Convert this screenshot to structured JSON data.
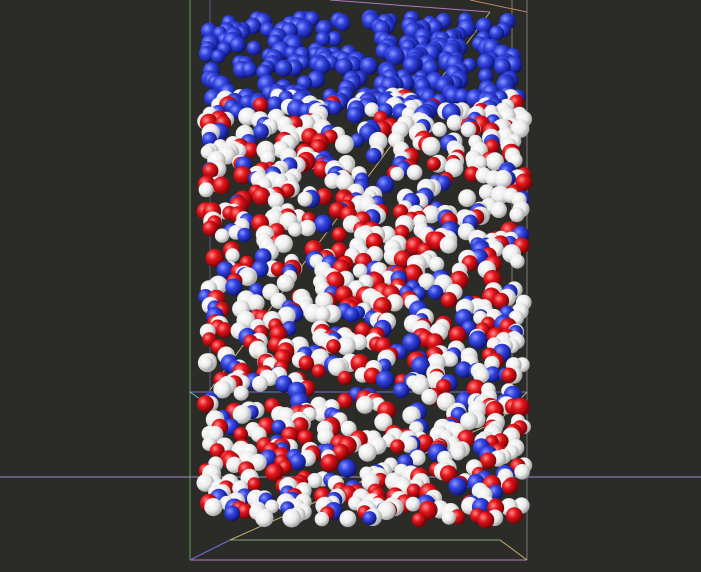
{
  "viewer": {
    "background_color": "#2b2b28"
  },
  "colors": {
    "blue_atom": "#2f3fd6",
    "red_atom": "#e0141a",
    "white_atom": "#f2f2f2",
    "box_edge_green": "#7faa6b",
    "box_edge_blue": "#6f6fd8",
    "box_edge_purple": "#b87ad0",
    "box_edge_yellow": "#c9b070",
    "box_edge_cyan": "#77b6c9",
    "axis_line": "#b0a0d0"
  },
  "icons": [
    "simulation-box-outline",
    "molecule-cluster"
  ]
}
